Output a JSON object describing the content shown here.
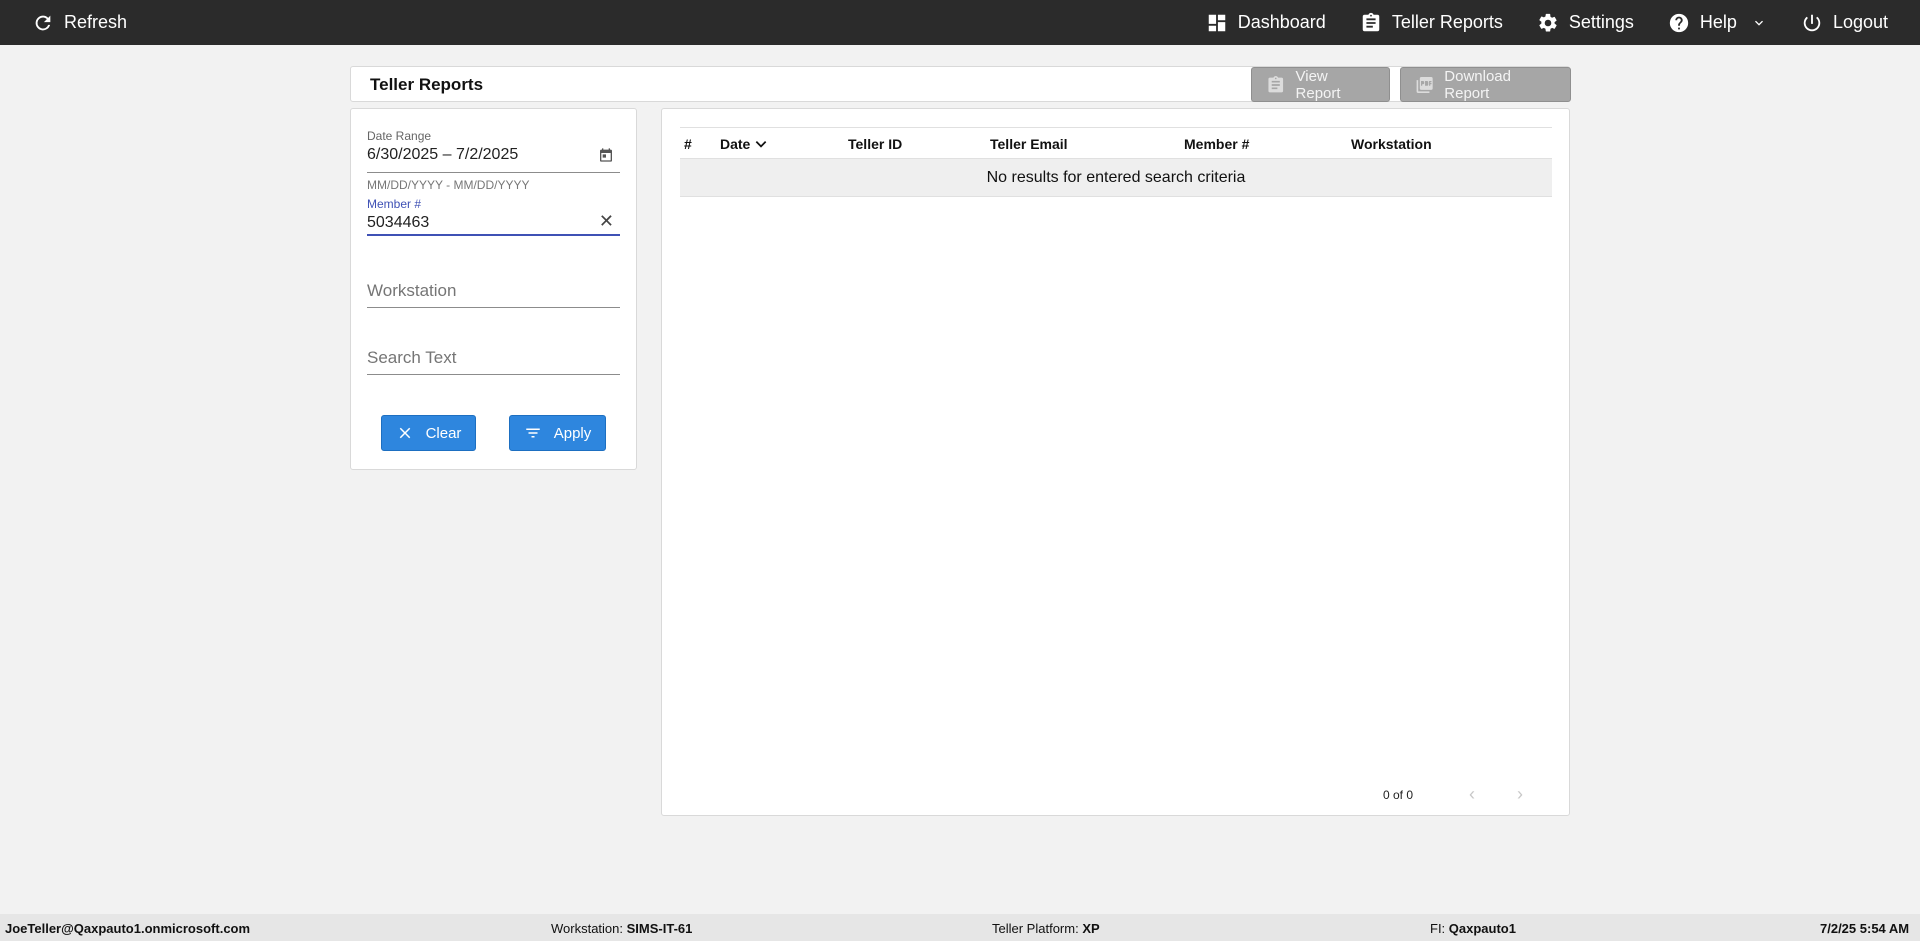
{
  "topbar": {
    "refresh_label": "Refresh",
    "nav": {
      "dashboard": "Dashboard",
      "teller_reports": "Teller Reports",
      "settings": "Settings",
      "help": "Help",
      "logout": "Logout"
    }
  },
  "page": {
    "title": "Teller Reports",
    "view_report_label": "View Report",
    "download_report_label": "Download Report"
  },
  "filters": {
    "date_range": {
      "label": "Date Range",
      "value": "6/30/2025 – 7/2/2025",
      "hint": "MM/DD/YYYY - MM/DD/YYYY"
    },
    "member": {
      "label": "Member #",
      "value": "5034463"
    },
    "workstation": {
      "placeholder": "Workstation"
    },
    "search_text": {
      "placeholder": "Search Text"
    },
    "clear_label": "Clear",
    "apply_label": "Apply"
  },
  "table": {
    "columns": [
      "#",
      "Date",
      "Teller ID",
      "Teller Email",
      "Member #",
      "Workstation"
    ],
    "empty_message": "No results for entered search criteria",
    "pagination": "0 of 0"
  },
  "statusbar": {
    "user": "JoeTeller@Qaxpauto1.onmicrosoft.com",
    "workstation_label": "Workstation:",
    "workstation_value": "SIMS-IT-61",
    "platform_label": "Teller Platform:",
    "platform_value": "XP",
    "fi_label": "FI:",
    "fi_value": "Qaxpauto1",
    "datetime": "7/2/25 5:54 AM"
  },
  "colors": {
    "topbar": "#2b2b2b",
    "accent_blue": "#2e86de",
    "focus_indigo": "#3f51b5",
    "disabled_button": "#a6a6a6"
  }
}
